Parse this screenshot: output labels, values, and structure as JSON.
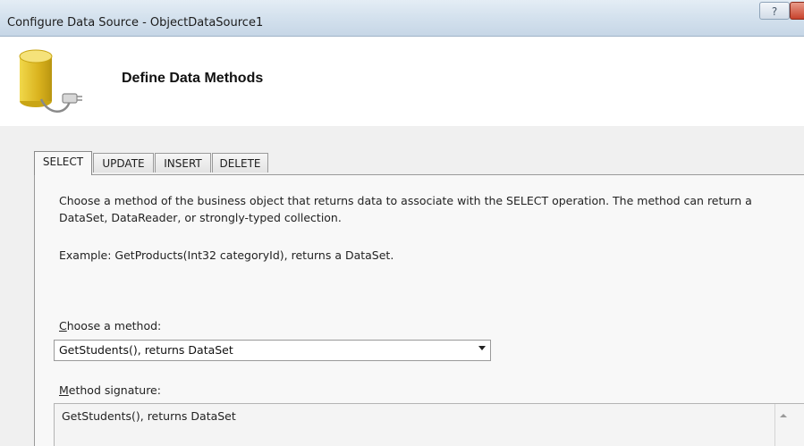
{
  "window": {
    "title": "Configure Data Source - ObjectDataSource1",
    "help_label": "?"
  },
  "header": {
    "title": "Define Data Methods",
    "icon": "database-icon"
  },
  "tabs": [
    {
      "label": "SELECT",
      "active": true
    },
    {
      "label": "UPDATE",
      "active": false
    },
    {
      "label": "INSERT",
      "active": false
    },
    {
      "label": "DELETE",
      "active": false
    }
  ],
  "panel": {
    "description_line1": "Choose a method of the business object that returns data to associate with the SELECT operation. The method can return a",
    "description_line2": "DataSet, DataReader, or strongly-typed collection.",
    "example": "Example: GetProducts(Int32 categoryId), returns a DataSet.",
    "method_label_mnemonic": "C",
    "method_label_rest": "hoose a method:",
    "method_selected": "GetStudents(), returns DataSet",
    "signature_label_mnemonic": "M",
    "signature_label_rest": "ethod signature:",
    "signature_value": "GetStudents(), returns DataSet"
  }
}
